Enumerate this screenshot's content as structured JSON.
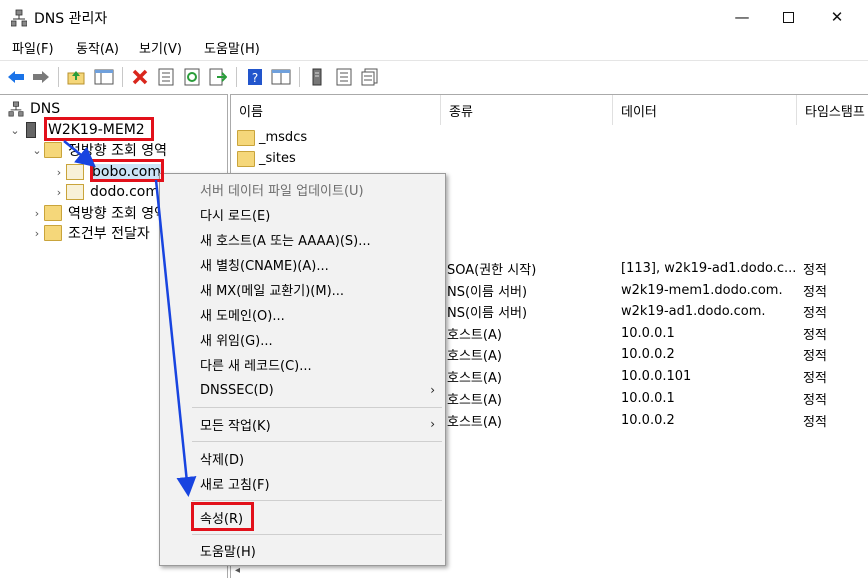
{
  "window": {
    "title": "DNS 관리자",
    "controls": {
      "minimize": "—",
      "maximize": "",
      "close": "✕"
    }
  },
  "menubar": [
    "파일(F)",
    "동작(A)",
    "보기(V)",
    "도움말(H)"
  ],
  "toolbar": {
    "buttons": [
      "back-icon",
      "forward-icon",
      "up-folder-icon",
      "show-tree-icon",
      "delete-icon",
      "properties-icon",
      "refresh-icon",
      "export-icon",
      "help-icon",
      "console-icon",
      "server-icon",
      "list-icon",
      "records-icon"
    ],
    "colors": {
      "back": "#1a73e8",
      "delete": "#d9261c",
      "help": "#2255cc"
    }
  },
  "tree": {
    "root": "DNS",
    "server": "W2K19-MEM2",
    "forward_zones": "정방향 조회 영역",
    "zones": [
      "bobo.com",
      "dodo.com"
    ],
    "reverse_zones": "역방향 조회 영역",
    "conditional_forwarders": "조건부 전달자"
  },
  "list": {
    "columns": [
      "이름",
      "종류",
      "데이터",
      "타임스탬프"
    ],
    "folders": [
      "_msdcs",
      "_sites"
    ],
    "records": [
      {
        "type": "SOA(권한 시작)",
        "data": "[113], w2k19-ad1.dodo.c...",
        "timestamp": "정적"
      },
      {
        "type": "NS(이름 서버)",
        "data": "w2k19-mem1.dodo.com.",
        "timestamp": "정적"
      },
      {
        "type": "NS(이름 서버)",
        "data": "w2k19-ad1.dodo.com.",
        "timestamp": "정적"
      },
      {
        "type": "호스트(A)",
        "data": "10.0.0.1",
        "timestamp": "정적"
      },
      {
        "type": "호스트(A)",
        "data": "10.0.0.2",
        "timestamp": "정적"
      },
      {
        "type": "호스트(A)",
        "data": "10.0.0.101",
        "timestamp": "정적"
      },
      {
        "type": "호스트(A)",
        "data": "10.0.0.1",
        "timestamp": "정적"
      },
      {
        "type": "호스트(A)",
        "data": "10.0.0.2",
        "timestamp": "정적"
      }
    ]
  },
  "context_menu": {
    "items": [
      "서버 데이터 파일 업데이트(U)",
      "다시 로드(E)",
      "새 호스트(A 또는 AAAA)(S)...",
      "새 별칭(CNAME)(A)...",
      "새 MX(메일 교환기)(M)...",
      "새 도메인(O)...",
      "새 위임(G)...",
      "다른 새 레코드(C)...",
      "DNSSEC(D)",
      "모든 작업(K)",
      "삭제(D)",
      "새로 고침(F)",
      "속성(R)",
      "도움말(H)"
    ],
    "submenu_arrow": "›"
  },
  "annotation": {
    "highlight_color": "#e2101a",
    "arrow_color": "#1844e0"
  }
}
